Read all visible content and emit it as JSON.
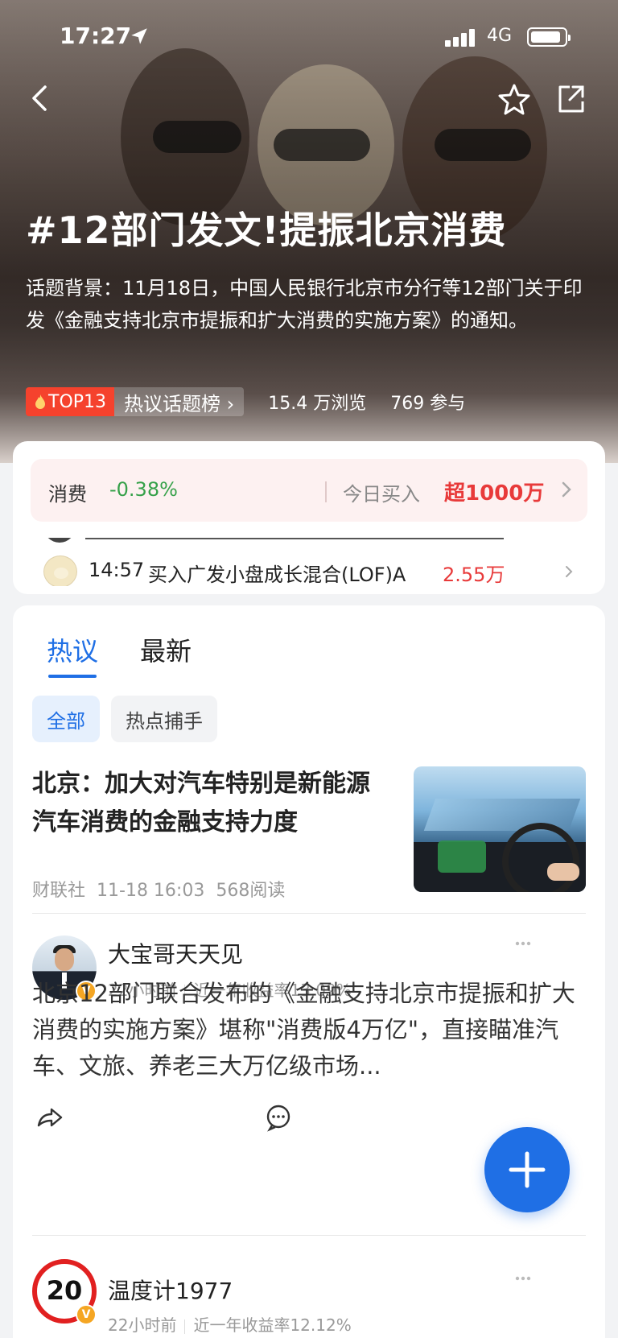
{
  "status_bar": {
    "time": "17:27",
    "network": "4G"
  },
  "topic": {
    "title": "#12部门发文!提振北京消费",
    "description": "话题背景：11月18日，中国人民银行北京市分行等12部门关于印发《金融支持北京市提振和扩大消费的实施方案》的通知。",
    "rank_badge": "TOP13",
    "rank_label": "热议话题榜 ›",
    "views": "15.4 万浏览",
    "participants": "769 参与"
  },
  "sector": {
    "name": "消费",
    "change": "-0.38%",
    "today_label": "今日买入",
    "today_value": "超1000万"
  },
  "ticker": {
    "time": "14:57",
    "text": "买入广发小盘成长混合(LOF)A",
    "amount": "2.55万"
  },
  "tabs": {
    "hot": "热议",
    "latest": "最新"
  },
  "chips": {
    "all": "全部",
    "hot_hunter": "热点捕手"
  },
  "news": {
    "title": "北京：加大对汽车特别是新能源汽车消费的金融支持力度",
    "source": "财联社",
    "time": "11-18 16:03",
    "reads": "568阅读"
  },
  "posts": [
    {
      "author": "大宝哥天天见",
      "time": "22小时前",
      "return_label": "近一年收益率13.09%",
      "body": "北京12部门联合发布的《金融支持北京市提振和扩大消费的实施方案》堪称\"消费版4万亿\"，直接瞄准汽车、文旅、养老三大万亿级市场..."
    },
    {
      "author": "温度计1977",
      "avatar_text": "20",
      "time": "22小时前",
      "return_label": "近一年收益率12.12%"
    }
  ],
  "badges": {
    "verified": "V"
  },
  "colors": {
    "accent": "#1f6fe5",
    "up": "#e83a3a",
    "down": "#36a14a",
    "rank": "#f5422d"
  },
  "icons": [
    "back-icon",
    "star-icon",
    "share-icon",
    "chevron-right-icon",
    "more-icon",
    "repost-icon",
    "comment-icon",
    "plus-icon",
    "location-arrow-icon",
    "signal-icon",
    "battery-icon",
    "flame-icon"
  ]
}
